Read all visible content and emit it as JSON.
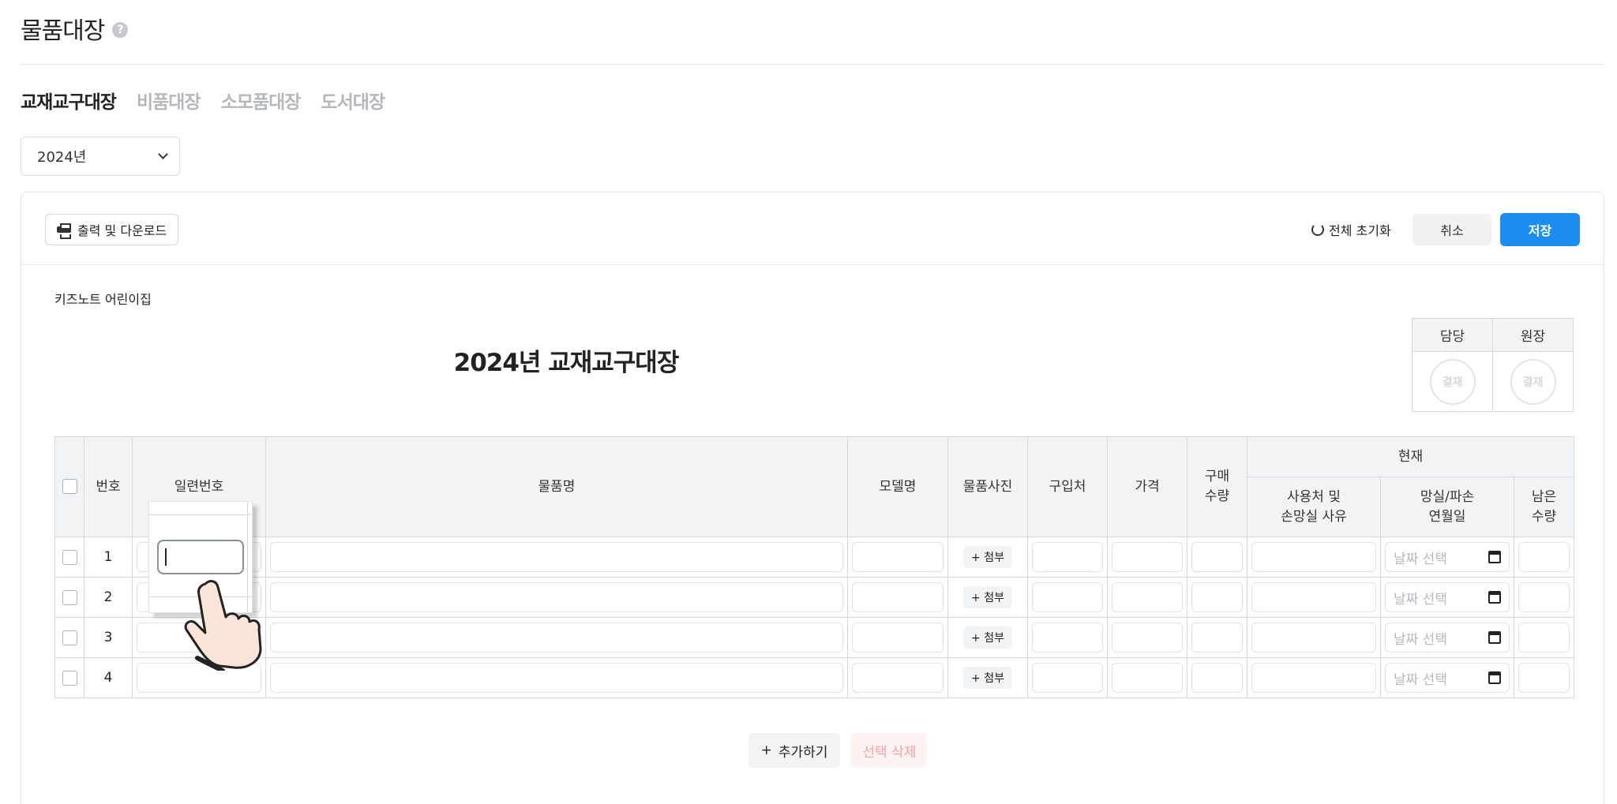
{
  "page": {
    "title": "물품대장",
    "help_icon": "question-circle-icon"
  },
  "tabs": [
    {
      "label": "교재교구대장",
      "active": true
    },
    {
      "label": "비품대장",
      "active": false
    },
    {
      "label": "소모품대장",
      "active": false
    },
    {
      "label": "도서대장",
      "active": false
    }
  ],
  "year_select": {
    "value": "2024년"
  },
  "toolbar": {
    "print_label": "출력 및 다운로드",
    "reset_label": "전체 초기화",
    "cancel_label": "취소",
    "save_label": "저장"
  },
  "document": {
    "org_name": "키즈노트 어린이집",
    "title": "2024년 교재교구대장",
    "approval": {
      "headers": [
        "담당",
        "원장"
      ],
      "stamp_label": "결재"
    }
  },
  "table": {
    "headers": {
      "no": "번호",
      "serial": "일련번호",
      "item_name": "물품명",
      "model": "모델명",
      "photo": "물품사진",
      "vendor": "구입처",
      "price": "가격",
      "purchase_qty": "구매\n수량",
      "current": "현재",
      "usage": "사용처 및\n손망실 사유",
      "loss_date": "망실/파손\n연월일",
      "remaining_qty": "남은\n수량"
    },
    "rows": [
      {
        "no": "1",
        "attach_label": "+ 첨부",
        "date_placeholder": "날짜 선택"
      },
      {
        "no": "2",
        "attach_label": "+ 첨부",
        "date_placeholder": "날짜 선택"
      },
      {
        "no": "3",
        "attach_label": "+ 첨부",
        "date_placeholder": "날짜 선택"
      },
      {
        "no": "4",
        "attach_label": "+ 첨부",
        "date_placeholder": "날짜 선택"
      }
    ]
  },
  "actions": {
    "add_label": "추가하기",
    "delete_label": "선택 삭제"
  },
  "colors": {
    "primary": "#1d8ef0",
    "danger_text": "#f3a3a3",
    "header_bg": "#f1f3f5"
  }
}
